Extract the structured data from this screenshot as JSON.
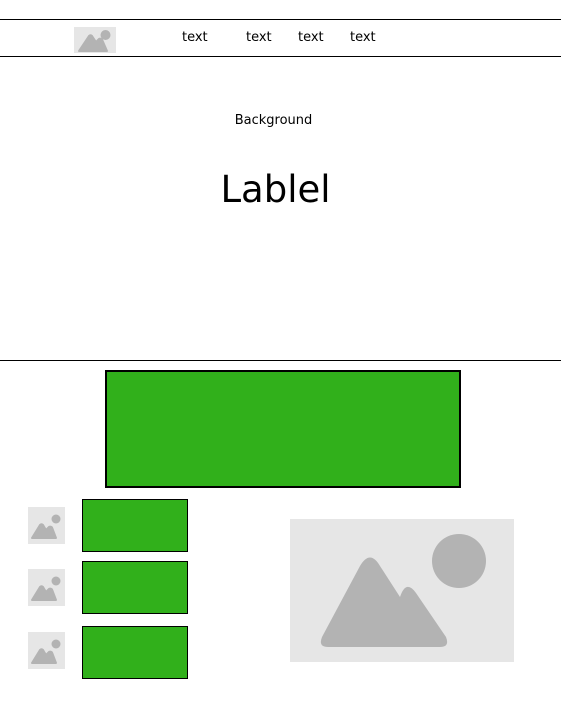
{
  "header": {
    "logo_icon": "image-placeholder-icon",
    "nav_links": [
      "text",
      "text",
      "text",
      "text"
    ]
  },
  "hero": {
    "background_label": "Background",
    "title": "Lablel"
  },
  "content": {
    "banner_color": "#31b01b",
    "list_items": [
      {
        "thumbnail_icon": "image-placeholder-icon",
        "card_color": "#31b01b"
      },
      {
        "thumbnail_icon": "image-placeholder-icon",
        "card_color": "#31b01b"
      },
      {
        "thumbnail_icon": "image-placeholder-icon",
        "card_color": "#31b01b"
      }
    ],
    "feature_image_icon": "image-placeholder-icon"
  },
  "colors": {
    "accent_green": "#31b01b",
    "placeholder_bg": "#e6e6e6",
    "placeholder_fg": "#b3b3b3"
  }
}
